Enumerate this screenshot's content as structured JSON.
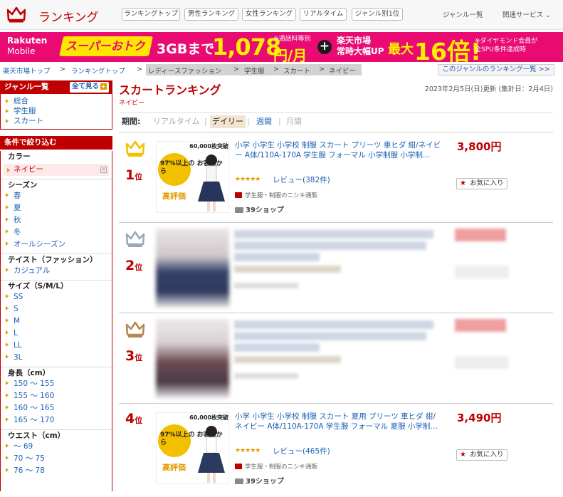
{
  "header": {
    "logo_text": "ランキング",
    "nav": [
      "ランキングトップ",
      "男性ランキング",
      "女性ランキング",
      "リアルタイム",
      "ジャンル別1位"
    ],
    "genre_list": "ジャンル一覧",
    "related_services": "関連サービス ⌄"
  },
  "banner": {
    "brand_line1": "Rakuten",
    "brand_line2": "Mobile",
    "super": "スーパーおトク",
    "gb": "3GBまで",
    "price": "1,078",
    "yen": "円/月",
    "note1": "※通話料等別",
    "plus": "+",
    "ichiba1": "楽天市場",
    "ichiba2": "常時大幅UP",
    "max": "最大",
    "mult": "16倍!",
    "note2a": "※ダイヤモンド会員が",
    "note2b": "全SPU条件達成時"
  },
  "breadcrumb": {
    "items": [
      "楽天市場トップ",
      "ランキングトップ",
      "レディースファッション",
      "学生服",
      "スカート",
      "ネイビー"
    ],
    "sep": ">",
    "genre_ranking_link": "このジャンルのランキング一覧 >>"
  },
  "sidebar": {
    "genre_title": "ジャンル一覧",
    "see_all": "全て見る",
    "genres": [
      "総合",
      "学生服",
      "スカート"
    ],
    "filter_title": "条件で絞り込む",
    "color_title": "カラー",
    "color_selected": "ネイビー",
    "season_title": "シーズン",
    "seasons": [
      "春",
      "夏",
      "秋",
      "冬",
      "オールシーズン"
    ],
    "taste_title": "テイスト（ファッション）",
    "tastes": [
      "カジュアル"
    ],
    "size_title": "サイズ（S/M/L）",
    "sizes": [
      "SS",
      "S",
      "M",
      "L",
      "LL",
      "3L"
    ],
    "height_title": "身長（cm）",
    "heights": [
      "150 ～ 155",
      "155 ～ 160",
      "160 ～ 165",
      "165 ～ 170"
    ],
    "waist_title": "ウエスト（cm）",
    "waists": [
      "～ 69",
      "70 ～ 75",
      "76 ～ 78"
    ]
  },
  "main": {
    "title": "スカートランキング",
    "subtitle": "ネイビー",
    "updated": "2023年2月5日(日)更新 (集計日：2月4日)",
    "period_label": "期間:",
    "periods": [
      "リアルタイム",
      "デイリー",
      "週間",
      "月間"
    ],
    "period_sep": "|"
  },
  "items": [
    {
      "rank": "1",
      "rank_suffix": "位",
      "title": "小学 小学生 小学校 制服 スカート プリーツ 車ヒダ 紺/ネイビー A体/110A-170A 学生服 フォーマル 小学制服 小学制…",
      "stars": "★★★★★",
      "review": "レビュー(382件)",
      "shop": "学生服・制服のニシキ通販",
      "count": "39ショップ",
      "price": "3,800円",
      "fav": "お気に入り",
      "thumb_banner": "60,000枚突破",
      "thumb_circle": "97%以上の お客様から",
      "thumb_hi": "高評価",
      "crown_color": "#f2c200"
    },
    {
      "rank": "2",
      "rank_suffix": "位",
      "crown_color": "#9aa8bb"
    },
    {
      "rank": "3",
      "rank_suffix": "位",
      "crown_color": "#b58a52"
    },
    {
      "rank": "4",
      "rank_suffix": "位",
      "title": "小学 小学生 小学校 制服 スカート 夏用 プリーツ 車ヒダ 紺/ネイビー A体/110A-170A 学生服 フォーマル 夏服 小学制…",
      "stars": "★★★★★",
      "review": "レビュー(465件)",
      "shop": "学生服・制服のニシキ通販",
      "count": "39ショップ",
      "price": "3,490円",
      "fav": "お気に入り",
      "thumb_banner": "60,000枚突破",
      "thumb_circle": "97%以上の お客様から",
      "thumb_hi": "高評価"
    }
  ],
  "colors": {
    "brand_red": "#bf0000",
    "banner_pink": "#e90a72",
    "link_blue": "#1a5fb4"
  }
}
